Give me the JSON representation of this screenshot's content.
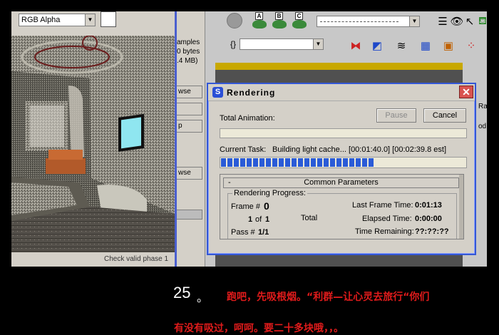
{
  "frame_buffer": {
    "channel_select": "RGB Alpha"
  },
  "mid_panel": {
    "text_amples": "amples",
    "text_bytes": "0 bytes",
    "text_mb": ".4 MB)",
    "btn_browse_1": "wse",
    "btn_p": "p",
    "btn_browse_2": "wse"
  },
  "command_panel": {
    "label_top": "Ray",
    "label_mod": "od"
  },
  "bottom_status": "Check valid phase 1",
  "dialog": {
    "title": "Rendering",
    "total_animation_label": "Total Animation:",
    "pause_label": "Pause",
    "cancel_label": "Cancel",
    "current_task_label": "Current Task:",
    "current_task_value": "Building light cache... [00:01:40.0] [00:02:39.8 est]",
    "task_progress": 0.63,
    "rollout_title": "Common Parameters",
    "rollout_toggle": "-",
    "group_title": "Rendering Progress:",
    "frame_label": "Frame #",
    "frame_value": "0",
    "frame_count_a": "1",
    "frame_of": "of",
    "frame_count_b": "1",
    "total_label": "Total",
    "pass_label": "Pass #",
    "pass_value": "1/1",
    "last_frame_time_label": "Last Frame Time:",
    "last_frame_time_value": "0:01:13",
    "elapsed_time_label": "Elapsed Time:",
    "elapsed_time_value": "0:00:00",
    "time_remaining_label": "Time Remaining:",
    "time_remaining_value": "??:??:??"
  },
  "caption": {
    "step_number": "25",
    "step_sep": "。",
    "line1": "跑吧，先吸根烟。“利群—让心灵去旅行“你们",
    "line2": "有没有吸过，呵呵。要二十多块哦，，。"
  }
}
